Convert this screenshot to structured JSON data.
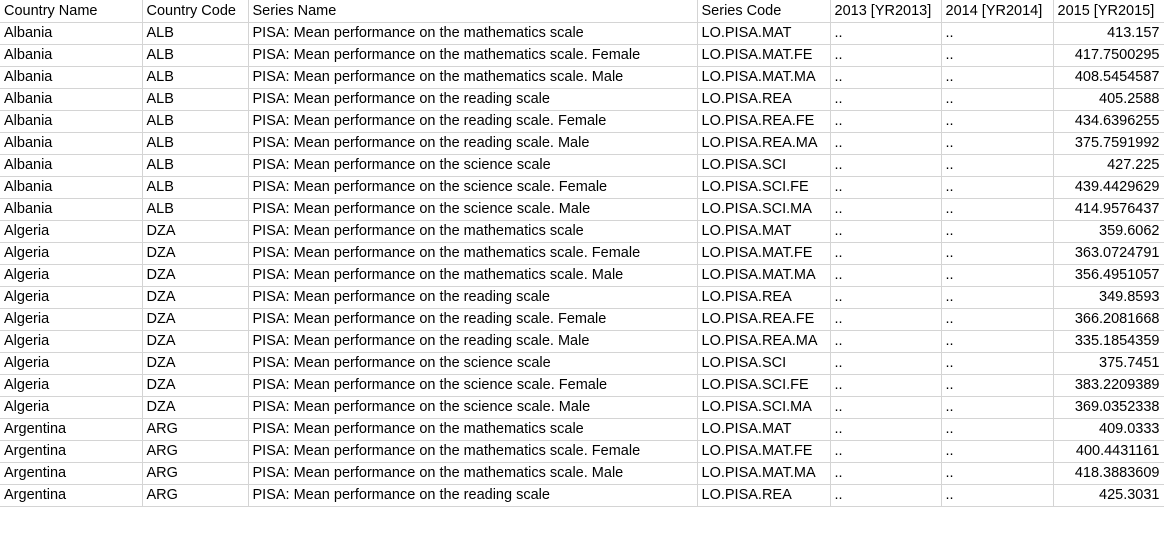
{
  "grid": {
    "columns": [
      "Country Name",
      "Country Code",
      "Series Name",
      "Series Code",
      "2013 [YR2013]",
      "2014 [YR2014]",
      "2015 [YR2015]"
    ],
    "rows": [
      [
        "Albania",
        "ALB",
        "PISA: Mean performance on the mathematics scale",
        "LO.PISA.MAT",
        "..",
        "..",
        "413.157"
      ],
      [
        "Albania",
        "ALB",
        "PISA: Mean performance on the mathematics scale. Female",
        "LO.PISA.MAT.FE",
        "..",
        "..",
        "417.7500295"
      ],
      [
        "Albania",
        "ALB",
        "PISA: Mean performance on the mathematics scale. Male",
        "LO.PISA.MAT.MA",
        "..",
        "..",
        "408.5454587"
      ],
      [
        "Albania",
        "ALB",
        "PISA: Mean performance on the reading scale",
        "LO.PISA.REA",
        "..",
        "..",
        "405.2588"
      ],
      [
        "Albania",
        "ALB",
        "PISA: Mean performance on the reading scale. Female",
        "LO.PISA.REA.FE",
        "..",
        "..",
        "434.6396255"
      ],
      [
        "Albania",
        "ALB",
        "PISA: Mean performance on the reading scale. Male",
        "LO.PISA.REA.MA",
        "..",
        "..",
        "375.7591992"
      ],
      [
        "Albania",
        "ALB",
        "PISA: Mean performance on the science scale",
        "LO.PISA.SCI",
        "..",
        "..",
        "427.225"
      ],
      [
        "Albania",
        "ALB",
        "PISA: Mean performance on the science scale. Female",
        "LO.PISA.SCI.FE",
        "..",
        "..",
        "439.4429629"
      ],
      [
        "Albania",
        "ALB",
        "PISA: Mean performance on the science scale. Male",
        "LO.PISA.SCI.MA",
        "..",
        "..",
        "414.9576437"
      ],
      [
        "Algeria",
        "DZA",
        "PISA: Mean performance on the mathematics scale",
        "LO.PISA.MAT",
        "..",
        "..",
        "359.6062"
      ],
      [
        "Algeria",
        "DZA",
        "PISA: Mean performance on the mathematics scale. Female",
        "LO.PISA.MAT.FE",
        "..",
        "..",
        "363.0724791"
      ],
      [
        "Algeria",
        "DZA",
        "PISA: Mean performance on the mathematics scale. Male",
        "LO.PISA.MAT.MA",
        "..",
        "..",
        "356.4951057"
      ],
      [
        "Algeria",
        "DZA",
        "PISA: Mean performance on the reading scale",
        "LO.PISA.REA",
        "..",
        "..",
        "349.8593"
      ],
      [
        "Algeria",
        "DZA",
        "PISA: Mean performance on the reading scale. Female",
        "LO.PISA.REA.FE",
        "..",
        "..",
        "366.2081668"
      ],
      [
        "Algeria",
        "DZA",
        "PISA: Mean performance on the reading scale. Male",
        "LO.PISA.REA.MA",
        "..",
        "..",
        "335.1854359"
      ],
      [
        "Algeria",
        "DZA",
        "PISA: Mean performance on the science scale",
        "LO.PISA.SCI",
        "..",
        "..",
        "375.7451"
      ],
      [
        "Algeria",
        "DZA",
        "PISA: Mean performance on the science scale. Female",
        "LO.PISA.SCI.FE",
        "..",
        "..",
        "383.2209389"
      ],
      [
        "Algeria",
        "DZA",
        "PISA: Mean performance on the science scale. Male",
        "LO.PISA.SCI.MA",
        "..",
        "..",
        "369.0352338"
      ],
      [
        "Argentina",
        "ARG",
        "PISA: Mean performance on the mathematics scale",
        "LO.PISA.MAT",
        "..",
        "..",
        "409.0333"
      ],
      [
        "Argentina",
        "ARG",
        "PISA: Mean performance on the mathematics scale. Female",
        "LO.PISA.MAT.FE",
        "..",
        "..",
        "400.4431161"
      ],
      [
        "Argentina",
        "ARG",
        "PISA: Mean performance on the mathematics scale. Male",
        "LO.PISA.MAT.MA",
        "..",
        "..",
        "418.3883609"
      ],
      [
        "Argentina",
        "ARG",
        "PISA: Mean performance on the reading scale",
        "LO.PISA.REA",
        "..",
        "..",
        "425.3031"
      ]
    ]
  }
}
